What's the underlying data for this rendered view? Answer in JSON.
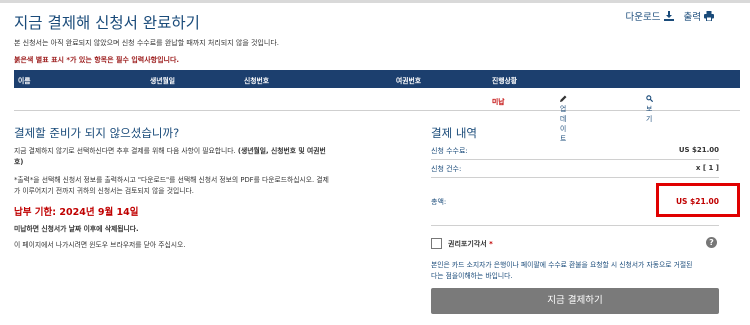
{
  "header": {
    "title": "지금 결제해 신청서 완료하기",
    "download_label": "다운로드",
    "print_label": "출력",
    "notice": "본 신청서는 아직 완료되지 않았으며 신청 수수료를 완납할 때까지 처리되지 않을 것입니다.",
    "required_note": "붉은색 별표 표시 *가 있는 항목은 필수 입력사항입니다."
  },
  "table": {
    "headers": [
      "이름",
      "생년월일",
      "신청번호",
      "여권번호",
      "진행상황"
    ],
    "rows": [
      {
        "status": "미납",
        "update_label": "업데이트",
        "view_label": "보기"
      }
    ]
  },
  "left": {
    "heading": "결제할 준비가 되지 않으셨습니까?",
    "para1_line1_prefix": "지금 결제하지 않기로 선택하신다면 추후 결제를 위해 다음 사항이 필요합니다. ",
    "para1_line1_bold": "(생년월일, 신청번호 및 여권번",
    "para1_line2_bold": "호)",
    "para2_line1": "*출력*을 선택해 신청서 정보를 출력하시고 \"다운로드\"를 선택해 신청서 정보의 PDF를 다운로드하십시오. 결제",
    "para2_line2": "가 이루어지기 전까지 귀하의 신청서는 검토되지 않을 것입니다.",
    "deadline": "납부 기한: 2024년 9월 14일",
    "deadline_note": "미납하면 신청서가 날짜 이후에 삭제됩니다.",
    "close_note": "이 페이지에서 나가시려면 윈도우 브라우저를 닫아 주십시오."
  },
  "summary": {
    "heading": "결제 내역",
    "fee_label": "신청 수수료:",
    "fee_value": "US $21.00",
    "count_label": "신청 건수:",
    "count_value": "x [ 1 ]",
    "total_label": "총액:",
    "total_value": "US $21.00",
    "waiver_label": "권리포기각서",
    "waiver_star": "*",
    "waiver_text_line1": "본인은 카드 소지자가 은행이나 페이팔에 수수료 환불을 요청할 시 신청서가 자동으로 거절된",
    "waiver_text_line2": "다는 점을이해하는 바입니다.",
    "pay_button": "지금 결제하기"
  },
  "colors": {
    "accent": "#1a4b7a",
    "header_bg": "#1c3f6e",
    "alert": "#c00000",
    "button_bg": "#7a7a7a",
    "highlight_box": "#e00000"
  },
  "icons": [
    "download-icon",
    "print-icon",
    "pencil-icon",
    "search-icon",
    "question-icon"
  ]
}
